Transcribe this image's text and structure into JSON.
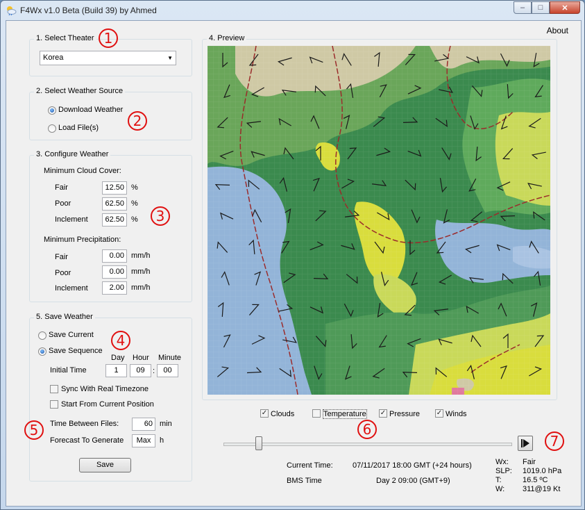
{
  "window": {
    "title": "F4Wx v1.0 Beta (Build 39) by Ahmed",
    "controls": [
      "minimize",
      "maximize",
      "close"
    ]
  },
  "menu": {
    "about": "About"
  },
  "theater": {
    "group_title": "1. Select Theater",
    "selected": "Korea"
  },
  "weather_source": {
    "group_title": "2. Select Weather Source",
    "download": "Download Weather",
    "load": "Load File(s)",
    "selected": "download"
  },
  "configure": {
    "group_title": "3. Configure Weather",
    "cloud_heading": "Minimum Cloud Cover:",
    "cloud": [
      {
        "label": "Fair",
        "value": "12.50",
        "unit": "%"
      },
      {
        "label": "Poor",
        "value": "62.50",
        "unit": "%"
      },
      {
        "label": "Inclement",
        "value": "62.50",
        "unit": "%"
      }
    ],
    "precip_heading": "Minimum Precipitation:",
    "precip": [
      {
        "label": "Fair",
        "value": "0.00",
        "unit": "mm/h"
      },
      {
        "label": "Poor",
        "value": "0.00",
        "unit": "mm/h"
      },
      {
        "label": "Inclement",
        "value": "2.00",
        "unit": "mm/h"
      }
    ]
  },
  "save": {
    "group_title": "5. Save Weather",
    "save_current": "Save Current",
    "save_sequence": "Save Sequence",
    "selected": "sequence",
    "col_day": "Day",
    "col_hour": "Hour",
    "col_minute": "Minute",
    "initial_time_label": "Initial Time",
    "day": "1",
    "hour": "09",
    "minute": "00",
    "separator": ":",
    "sync_label": "Sync With Real Timezone",
    "sync_checked": false,
    "start_label": "Start From Current Position",
    "start_checked": false,
    "between_label": "Time Between Files:",
    "between_value": "60",
    "between_unit": "min",
    "forecast_label": "Forecast To Generate",
    "forecast_value": "Max",
    "forecast_unit": "h",
    "button": "Save"
  },
  "preview": {
    "group_title": "4. Preview"
  },
  "layers": [
    {
      "label": "Clouds",
      "checked": true
    },
    {
      "label": "Temperature",
      "checked": false
    },
    {
      "label": "Pressure",
      "checked": true
    },
    {
      "label": "Winds",
      "checked": true
    }
  ],
  "timeline": {
    "position": 0.12
  },
  "status": {
    "current_time_label": "Current Time:",
    "current_time_value": "07/11/2017 18:00 GMT (+24 hours)",
    "bms_label": "BMS Time",
    "bms_value": "Day 2 09:00 (GMT+9)"
  },
  "readout": {
    "wx_label": "Wx:",
    "wx_value": "Fair",
    "slp_label": "SLP:",
    "slp_value": "1019.0 hPa",
    "t_label": "T:",
    "t_value": "16.5 ºC",
    "w_label": "W:",
    "w_value": "311@19 Kt"
  },
  "annotations": [
    "1",
    "2",
    "3",
    "4",
    "5",
    "6",
    "7"
  ],
  "colors": {
    "land_green": "#3b8a4e",
    "light_green": "#69a85a",
    "yellow": "#d9dd3d",
    "sea": "#93b4d8",
    "isobar": "#9b2b2b",
    "marker": "#e01010"
  }
}
